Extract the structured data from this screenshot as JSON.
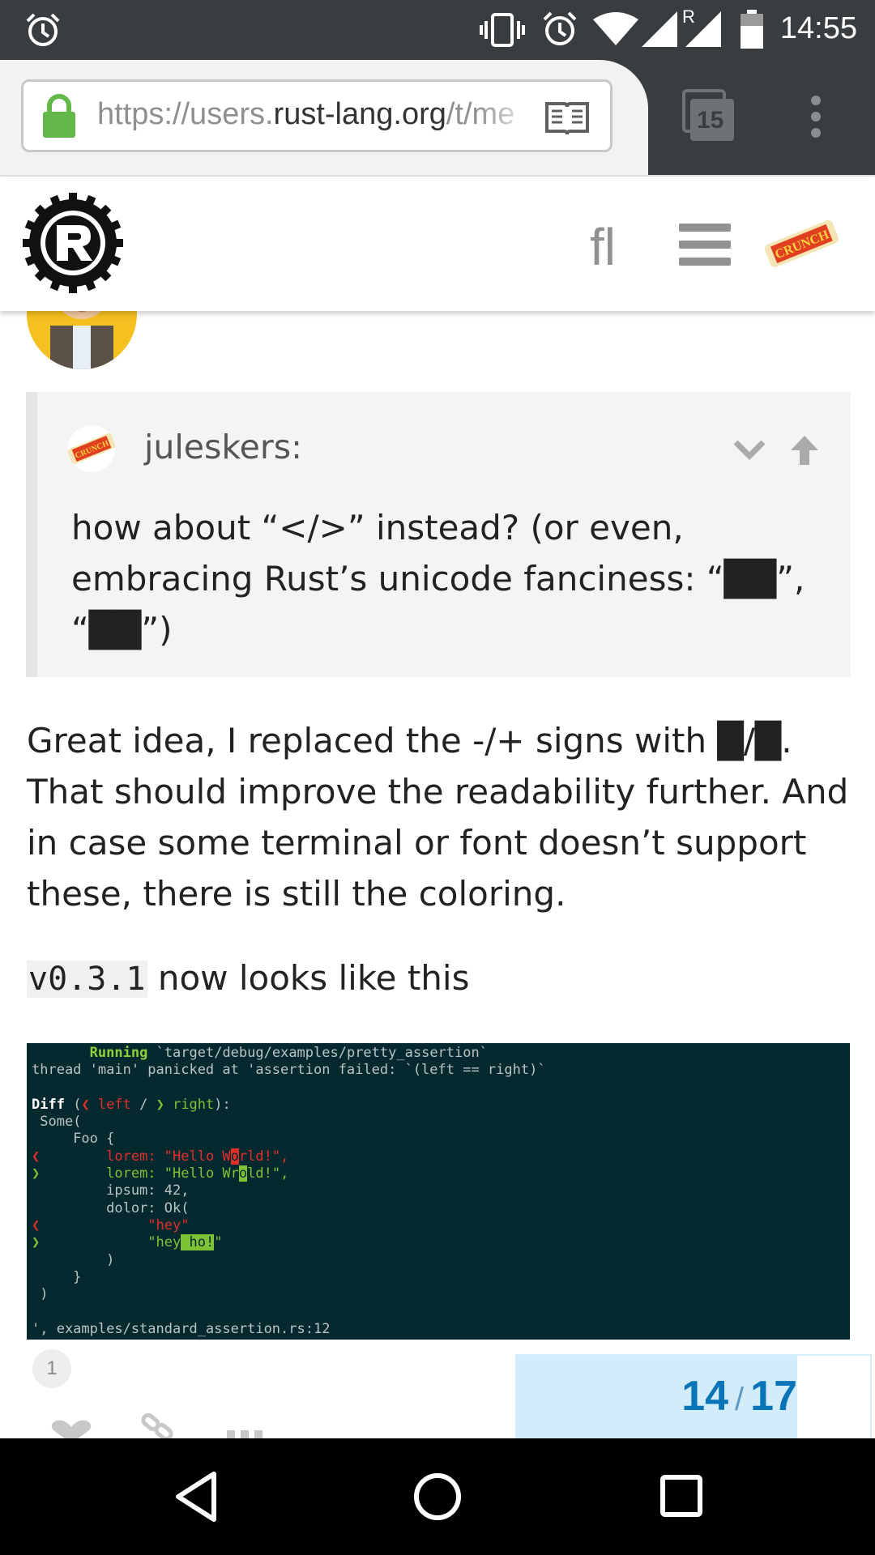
{
  "status_bar": {
    "time": "14:55",
    "roaming": "R"
  },
  "browser": {
    "url_light": "https://users.",
    "url_domain": "rust-lang.org",
    "url_tail": "/t/me",
    "tab_count": "15"
  },
  "site_header": {
    "search_glyph": "fl"
  },
  "quote": {
    "username": "juleskers:",
    "text": "how about “</>” instead? (or even, embracing Rust’s unicode fanciness: “██”, “██”)"
  },
  "post": {
    "paragraph": "Great idea, I replaced the -/+ signs with █/█. That should improve the readability further. And in case some terminal or font doesn’t support these, there is still the coloring.",
    "version_code": "v0.3.1",
    "version_suffix": " now looks like this"
  },
  "terminal": {
    "running_label": "Running",
    "running_path": "`target/debug/examples/pretty_assertion`",
    "panic_line": "thread 'main' panicked at 'assertion failed: `(left == right)`",
    "diff_label": "Diff",
    "left_label": "left",
    "right_label": "right",
    "footer_line": "', examples/standard_assertion.rs:12"
  },
  "footer": {
    "reply_count": "1",
    "progress_current": "14",
    "progress_total": "17"
  },
  "colors": {
    "progress_fill": "#d2ecfa",
    "progress_text": "#0a74b8",
    "lock_green": "#62b94a",
    "terminal_bg": "#06282f"
  }
}
